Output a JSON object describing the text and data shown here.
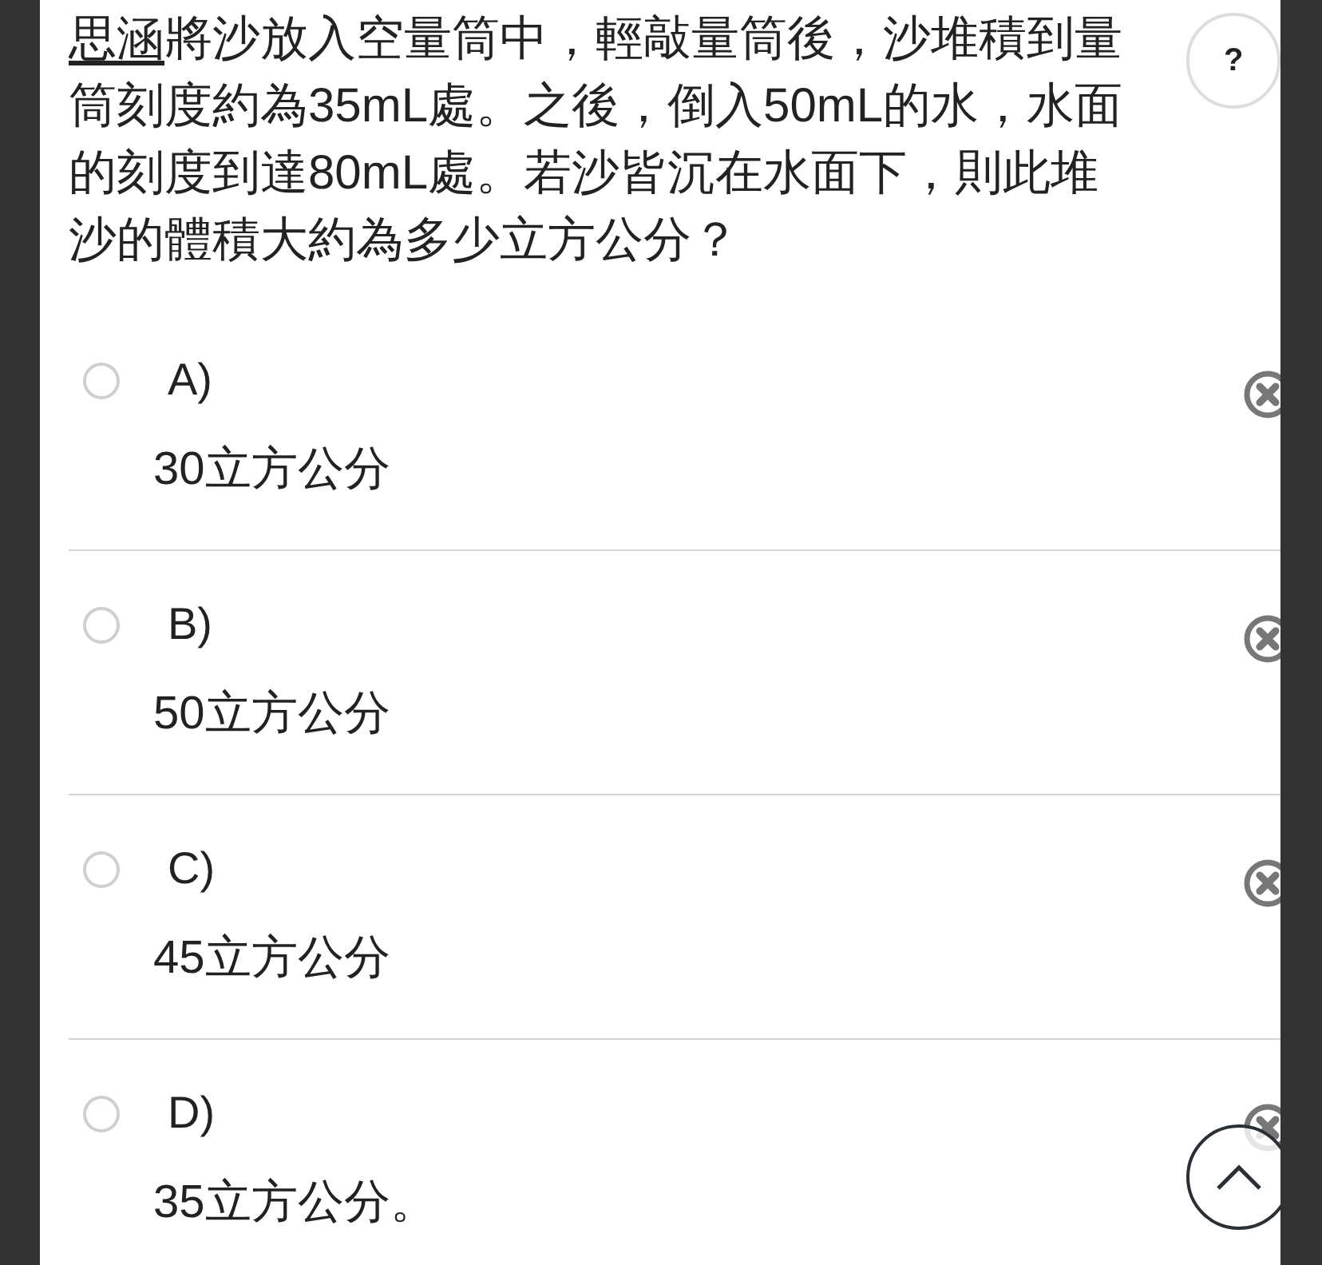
{
  "question": {
    "name": "思涵",
    "lines": [
      "將沙放入空量筒中，輕敲量筒後，沙堆積到量",
      "筒刻度約為35mL處。之後，倒入50mL的水，水面",
      "的刻度到達80mL處。若沙皆沉在水面下，則此堆",
      "沙的體積大約為多少立方公分？"
    ]
  },
  "help_button": "?",
  "options": [
    {
      "label": "A)",
      "answer": "30立方公分",
      "selected": false
    },
    {
      "label": "B)",
      "answer": "50立方公分",
      "selected": false
    },
    {
      "label": "C)",
      "answer": "45立方公分",
      "selected": false
    },
    {
      "label": "D)",
      "answer": "35立方公分。",
      "selected": false
    }
  ]
}
